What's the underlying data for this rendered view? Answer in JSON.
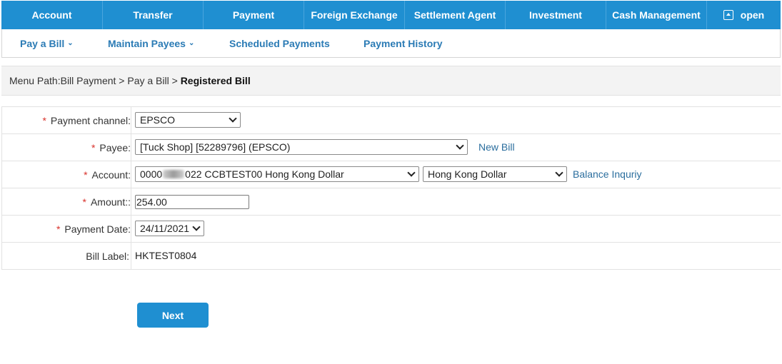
{
  "top_nav": {
    "items": [
      {
        "label": "Account"
      },
      {
        "label": "Transfer"
      },
      {
        "label": "Payment"
      },
      {
        "label": "Foreign Exchange"
      },
      {
        "label": "Settlement Agent"
      },
      {
        "label": "Investment"
      },
      {
        "label": "Cash Management"
      },
      {
        "label": "open",
        "icon": "panel-open-icon"
      }
    ]
  },
  "sub_nav": {
    "items": [
      {
        "label": "Pay a Bill",
        "has_dropdown": true
      },
      {
        "label": "Maintain Payees",
        "has_dropdown": true
      },
      {
        "label": "Scheduled Payments",
        "has_dropdown": false
      },
      {
        "label": "Payment History",
        "has_dropdown": false
      }
    ]
  },
  "breadcrumb": {
    "prefix": "Menu Path:Bill Payment > Pay a Bill > ",
    "current": "Registered Bill"
  },
  "form": {
    "required_mark": "*",
    "payment_channel": {
      "label": "Payment channel:",
      "value": "EPSCO"
    },
    "payee": {
      "label": "Payee:",
      "value": "[Tuck Shop] [52289796] (EPSCO)",
      "link": "New Bill"
    },
    "account": {
      "label": "Account:",
      "value_prefix": "0000",
      "value_suffix": "022 CCBTEST00 Hong Kong Dollar",
      "currency": "Hong Kong Dollar",
      "link": "Balance Inquriy"
    },
    "amount": {
      "label": "Amount::",
      "value": "254.00"
    },
    "payment_date": {
      "label": "Payment Date:",
      "value": "24/11/2021"
    },
    "bill_label": {
      "label": "Bill Label:",
      "value": "HKTEST0804"
    }
  },
  "actions": {
    "next": "Next"
  },
  "colors": {
    "primary": "#1f8fd1",
    "link": "#2b7bb5",
    "required": "#d9322c"
  }
}
